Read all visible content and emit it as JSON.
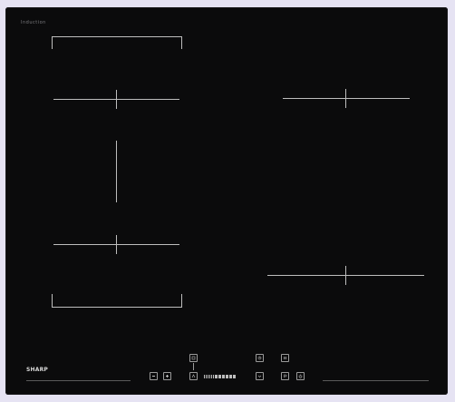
{
  "cooktop": {
    "top_logo": "Induction",
    "brand": "SHARP",
    "zones": [
      {
        "id": "zone-front-left-top",
        "label": ""
      },
      {
        "id": "zone-rear-right",
        "label": ""
      },
      {
        "id": "zone-front-left-bottom",
        "label": ""
      },
      {
        "id": "zone-front-right",
        "label": ""
      }
    ],
    "power_level_segments": 12,
    "keys": [
      {
        "name": "minus-key",
        "icon": "minus-icon"
      },
      {
        "name": "plus-key",
        "icon": "plus-icon"
      },
      {
        "name": "bridge-top-key",
        "icon": "bridge-icon"
      },
      {
        "name": "boost-key",
        "icon": "boost-icon"
      },
      {
        "name": "timer-key",
        "icon": "clock-icon"
      },
      {
        "name": "timer-down-key",
        "icon": "timer-down-icon"
      },
      {
        "name": "pause-top-key",
        "icon": "pause-icon"
      },
      {
        "name": "pause-key",
        "icon": "p-icon"
      },
      {
        "name": "power-key",
        "icon": "power-icon"
      }
    ]
  }
}
